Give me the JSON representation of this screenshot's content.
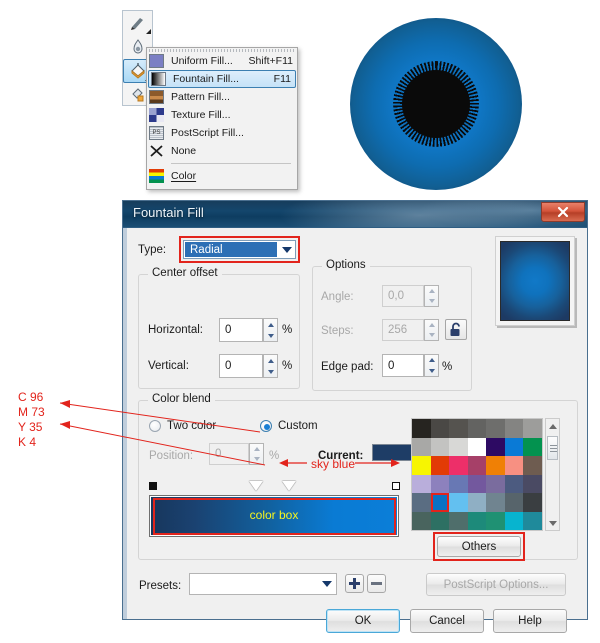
{
  "toolbox": {
    "tools": [
      {
        "name": "outline-pen-tool",
        "label": "Outline Pen"
      },
      {
        "name": "outline-color-tool",
        "label": "Outline Color"
      },
      {
        "name": "fill-tool",
        "label": "Fill Tool"
      },
      {
        "name": "interactive-fill-tool",
        "label": "Interactive Fill"
      }
    ]
  },
  "fill_menu": {
    "items": [
      {
        "label": "Uniform Fill...",
        "accel": "Shift+F11",
        "icon": "uniform-fill-icon",
        "highlight": false
      },
      {
        "label": "Fountain Fill...",
        "accel": "F11",
        "icon": "fountain-fill-icon",
        "highlight": true
      },
      {
        "label": "Pattern Fill...",
        "accel": "",
        "icon": "pattern-fill-icon",
        "highlight": false
      },
      {
        "label": "Texture Fill...",
        "accel": "",
        "icon": "texture-fill-icon",
        "highlight": false
      },
      {
        "label": "PostScript Fill...",
        "accel": "",
        "icon": "postscript-fill-icon",
        "highlight": false
      },
      {
        "label": "None",
        "accel": "",
        "icon": "none-x-icon",
        "highlight": false
      },
      {
        "label": "Color",
        "accel": "",
        "icon": "color-docker-icon",
        "highlight": false
      }
    ]
  },
  "artwork": {
    "name": "radial-fountain-fill-preview-circle",
    "outer_color": "#11395c",
    "mid_color": "#0f76c4",
    "core_color": "#0a0a0a"
  },
  "dialog": {
    "title": "Fountain Fill",
    "close_label": "✕",
    "type": {
      "label": "Type:",
      "value": "Radial",
      "highlighted": true
    },
    "center_offset": {
      "title": "Center offset",
      "horizontal_label": "Horizontal:",
      "horizontal_value": "0",
      "horizontal_unit": "%",
      "vertical_label": "Vertical:",
      "vertical_value": "0",
      "vertical_unit": "%"
    },
    "options": {
      "title": "Options",
      "angle_label": "Angle:",
      "angle_value": "0,0",
      "steps_label": "Steps:",
      "steps_value": "256",
      "lock_icon": "unlocked-padlock-icon",
      "edge_pad_label": "Edge pad:",
      "edge_pad_value": "0",
      "edge_pad_unit": "%"
    },
    "color_blend": {
      "title": "Color blend",
      "two_color_label": "Two color",
      "two_color_selected": false,
      "custom_label": "Custom",
      "custom_selected": true,
      "position_label": "Position:",
      "position_value": "0",
      "position_unit": "%",
      "current_label": "Current:",
      "current_color": "#1e3d66",
      "color_box_label": "color box",
      "others_label": "Others",
      "gradient_start": "#17365c",
      "gradient_end": "#0b7ed8",
      "palette": [
        [
          "#262420",
          "#4a4845",
          "#55534f",
          "#636361",
          "#6e6e6c",
          "#848482",
          "#9d9d9b"
        ],
        [
          "#a8a8a6",
          "#c3c3c1",
          "#d8d8d6",
          "#ffffff",
          "#2d0a63",
          "#0a7ad6",
          "#03924f"
        ],
        [
          "#f7f501",
          "#e23b06",
          "#ed2f69",
          "#a64068",
          "#f08005",
          "#f79082",
          "#6e5c50"
        ],
        [
          "#b9aedb",
          "#8d81bd",
          "#6878b4",
          "#73589e",
          "#7a6c9e",
          "#4c5b80",
          "#4a4a63"
        ],
        [
          "#5a6d82",
          "#0a72c4",
          "#63c0f0",
          "#8fafc4",
          "#708490",
          "#57646b",
          "#3a3e41"
        ],
        [
          "#49645e",
          "#2d7063",
          "#4f6e6b",
          "#1d8a7a",
          "#1f9173",
          "#07b4cf",
          "#1f8a9b"
        ]
      ],
      "selected_swatch": {
        "row": 4,
        "col": 1
      },
      "scroll_up_icon": "scroll-up-arrow-icon",
      "scroll_down_icon": "scroll-down-arrow-icon"
    },
    "presets": {
      "label": "Presets:",
      "value": "",
      "add_icon": "plus-icon",
      "remove_icon": "minus-icon",
      "postscript_label": "PostScript Options...",
      "postscript_enabled": false
    },
    "buttons": {
      "ok": "OK",
      "cancel": "Cancel",
      "help": "Help"
    }
  },
  "annotations": {
    "cmyk": [
      "C 96",
      "M 73",
      "Y 35",
      "K 4"
    ],
    "sky_blue": "sky blue",
    "accent_color": "#e2241c"
  }
}
